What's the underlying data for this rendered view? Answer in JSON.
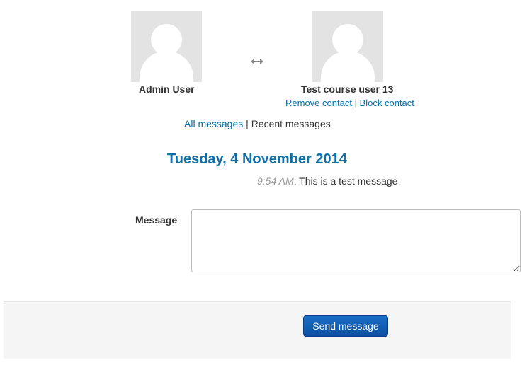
{
  "conversation": {
    "left_user": {
      "name": "Admin User",
      "avatar_icon": "default-user-icon"
    },
    "right_user": {
      "name": "Test course user 13",
      "avatar_icon": "default-user-icon",
      "remove_contact_label": "Remove contact",
      "block_contact_label": "Block contact"
    },
    "swap_icon": "bidirectional-arrow-icon",
    "separator": "|"
  },
  "nav": {
    "all_messages_label": "All messages",
    "separator": "|",
    "recent_messages_label": "Recent messages"
  },
  "history": {
    "date_heading": "Tuesday, 4 November 2014",
    "messages": [
      {
        "time": "9:54 AM",
        "text": ": This is a test message"
      }
    ]
  },
  "form": {
    "message_label": "Message",
    "message_value": "",
    "send_label": "Send message"
  },
  "colors": {
    "link": "#0070a8",
    "heading": "#0f6fa6",
    "button": "#0b4fa3",
    "avatar_bg": "#e3e3e3"
  }
}
